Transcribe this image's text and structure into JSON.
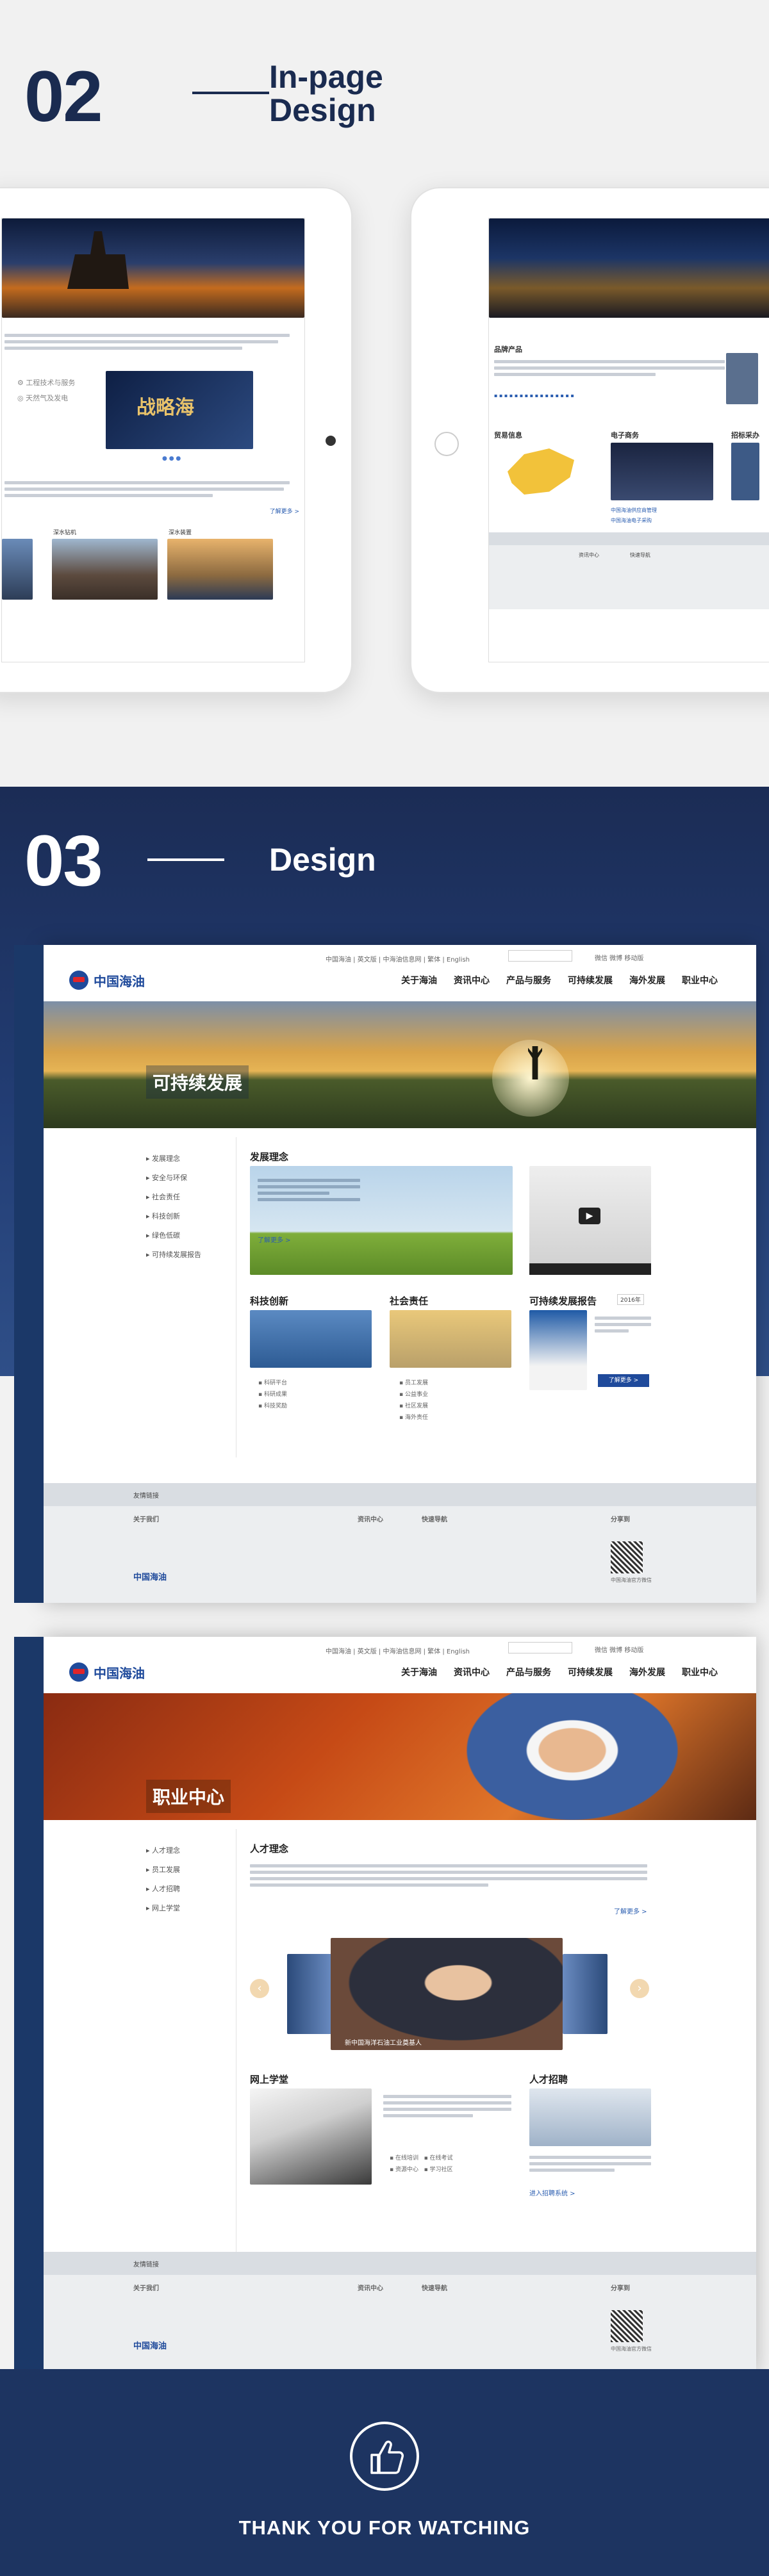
{
  "section02": {
    "number": "02",
    "title_line1": "In-page",
    "title_line2": "Design"
  },
  "section03": {
    "number": "03",
    "title": "Design"
  },
  "ipad_left": {
    "label_a": "工程技术与服务",
    "label_b": "天然气及发电",
    "banner_glyphs": "战略海",
    "thumb_a": "深水钻机",
    "thumb_b": "深水装置",
    "more": "了解更多 >"
  },
  "ipad_right": {
    "section_brand": "品牌产品",
    "col_trade": "贸易信息",
    "col_ecom": "电子商务",
    "col_bid": "招标采办",
    "link_a": "中国海油供应商管理",
    "link_b": "中国海油电子采购",
    "footer_a": "资讯中心",
    "footer_b": "快速导航"
  },
  "site1": {
    "topbar_links": "中国海油 | 英文版 | 中海油信息网 | 繁体 | English",
    "icons_label": "微信  微博  移动版",
    "logo": "中国海油",
    "nav": [
      "关于海油",
      "资讯中心",
      "产品与服务",
      "可持续发展",
      "海外发展",
      "职业中心"
    ],
    "banner_title": "可持续发展",
    "side_menu": [
      "发展理念",
      "安全与环保",
      "社会责任",
      "科技创新",
      "绿色低碳",
      "可持续发展报告"
    ],
    "h_concept": "发展理念",
    "concept_more": "了解更多 >",
    "h_tech": "科技创新",
    "h_social": "社会责任",
    "h_report": "可持续发展报告",
    "report_year": "2016年",
    "report_btn": "了解更多 >",
    "tech_links": [
      "科研平台",
      "科研成果",
      "科技奖励"
    ],
    "social_links": [
      "员工发展",
      "公益事业",
      "社区发展",
      "海外责任"
    ],
    "footer_friend": "友情链接",
    "footer_about": "关于我们",
    "footer_news": "资讯中心",
    "footer_nav": "快速导航",
    "footer_share": "分享到",
    "footer_wechat": "中国海油官方微信"
  },
  "site2": {
    "topbar_links": "中国海油 | 英文版 | 中海油信息网 | 繁体 | English",
    "icons_label": "微信  微博  移动版",
    "logo": "中国海油",
    "nav": [
      "关于海油",
      "资讯中心",
      "产品与服务",
      "可持续发展",
      "海外发展",
      "职业中心"
    ],
    "banner_title": "职业中心",
    "side_menu": [
      "人才理念",
      "员工发展",
      "人才招聘",
      "网上学堂"
    ],
    "h_talent": "人才理念",
    "more": "了解更多 >",
    "video_caption": "新中国海洋石油工业奠基人",
    "h_learning": "网上学堂",
    "h_recruit": "人才招聘",
    "learning_links": [
      "在线培训",
      "在线考试",
      "资源中心",
      "学习社区"
    ],
    "recruit_link": "进入招聘系统 >",
    "footer_friend": "友情链接",
    "footer_about": "关于我们",
    "footer_news": "资讯中心",
    "footer_nav": "快速导航",
    "footer_share": "分享到",
    "footer_wechat": "中国海油官方微信"
  },
  "closing": {
    "text": "THANK YOU FOR WATCHING"
  }
}
